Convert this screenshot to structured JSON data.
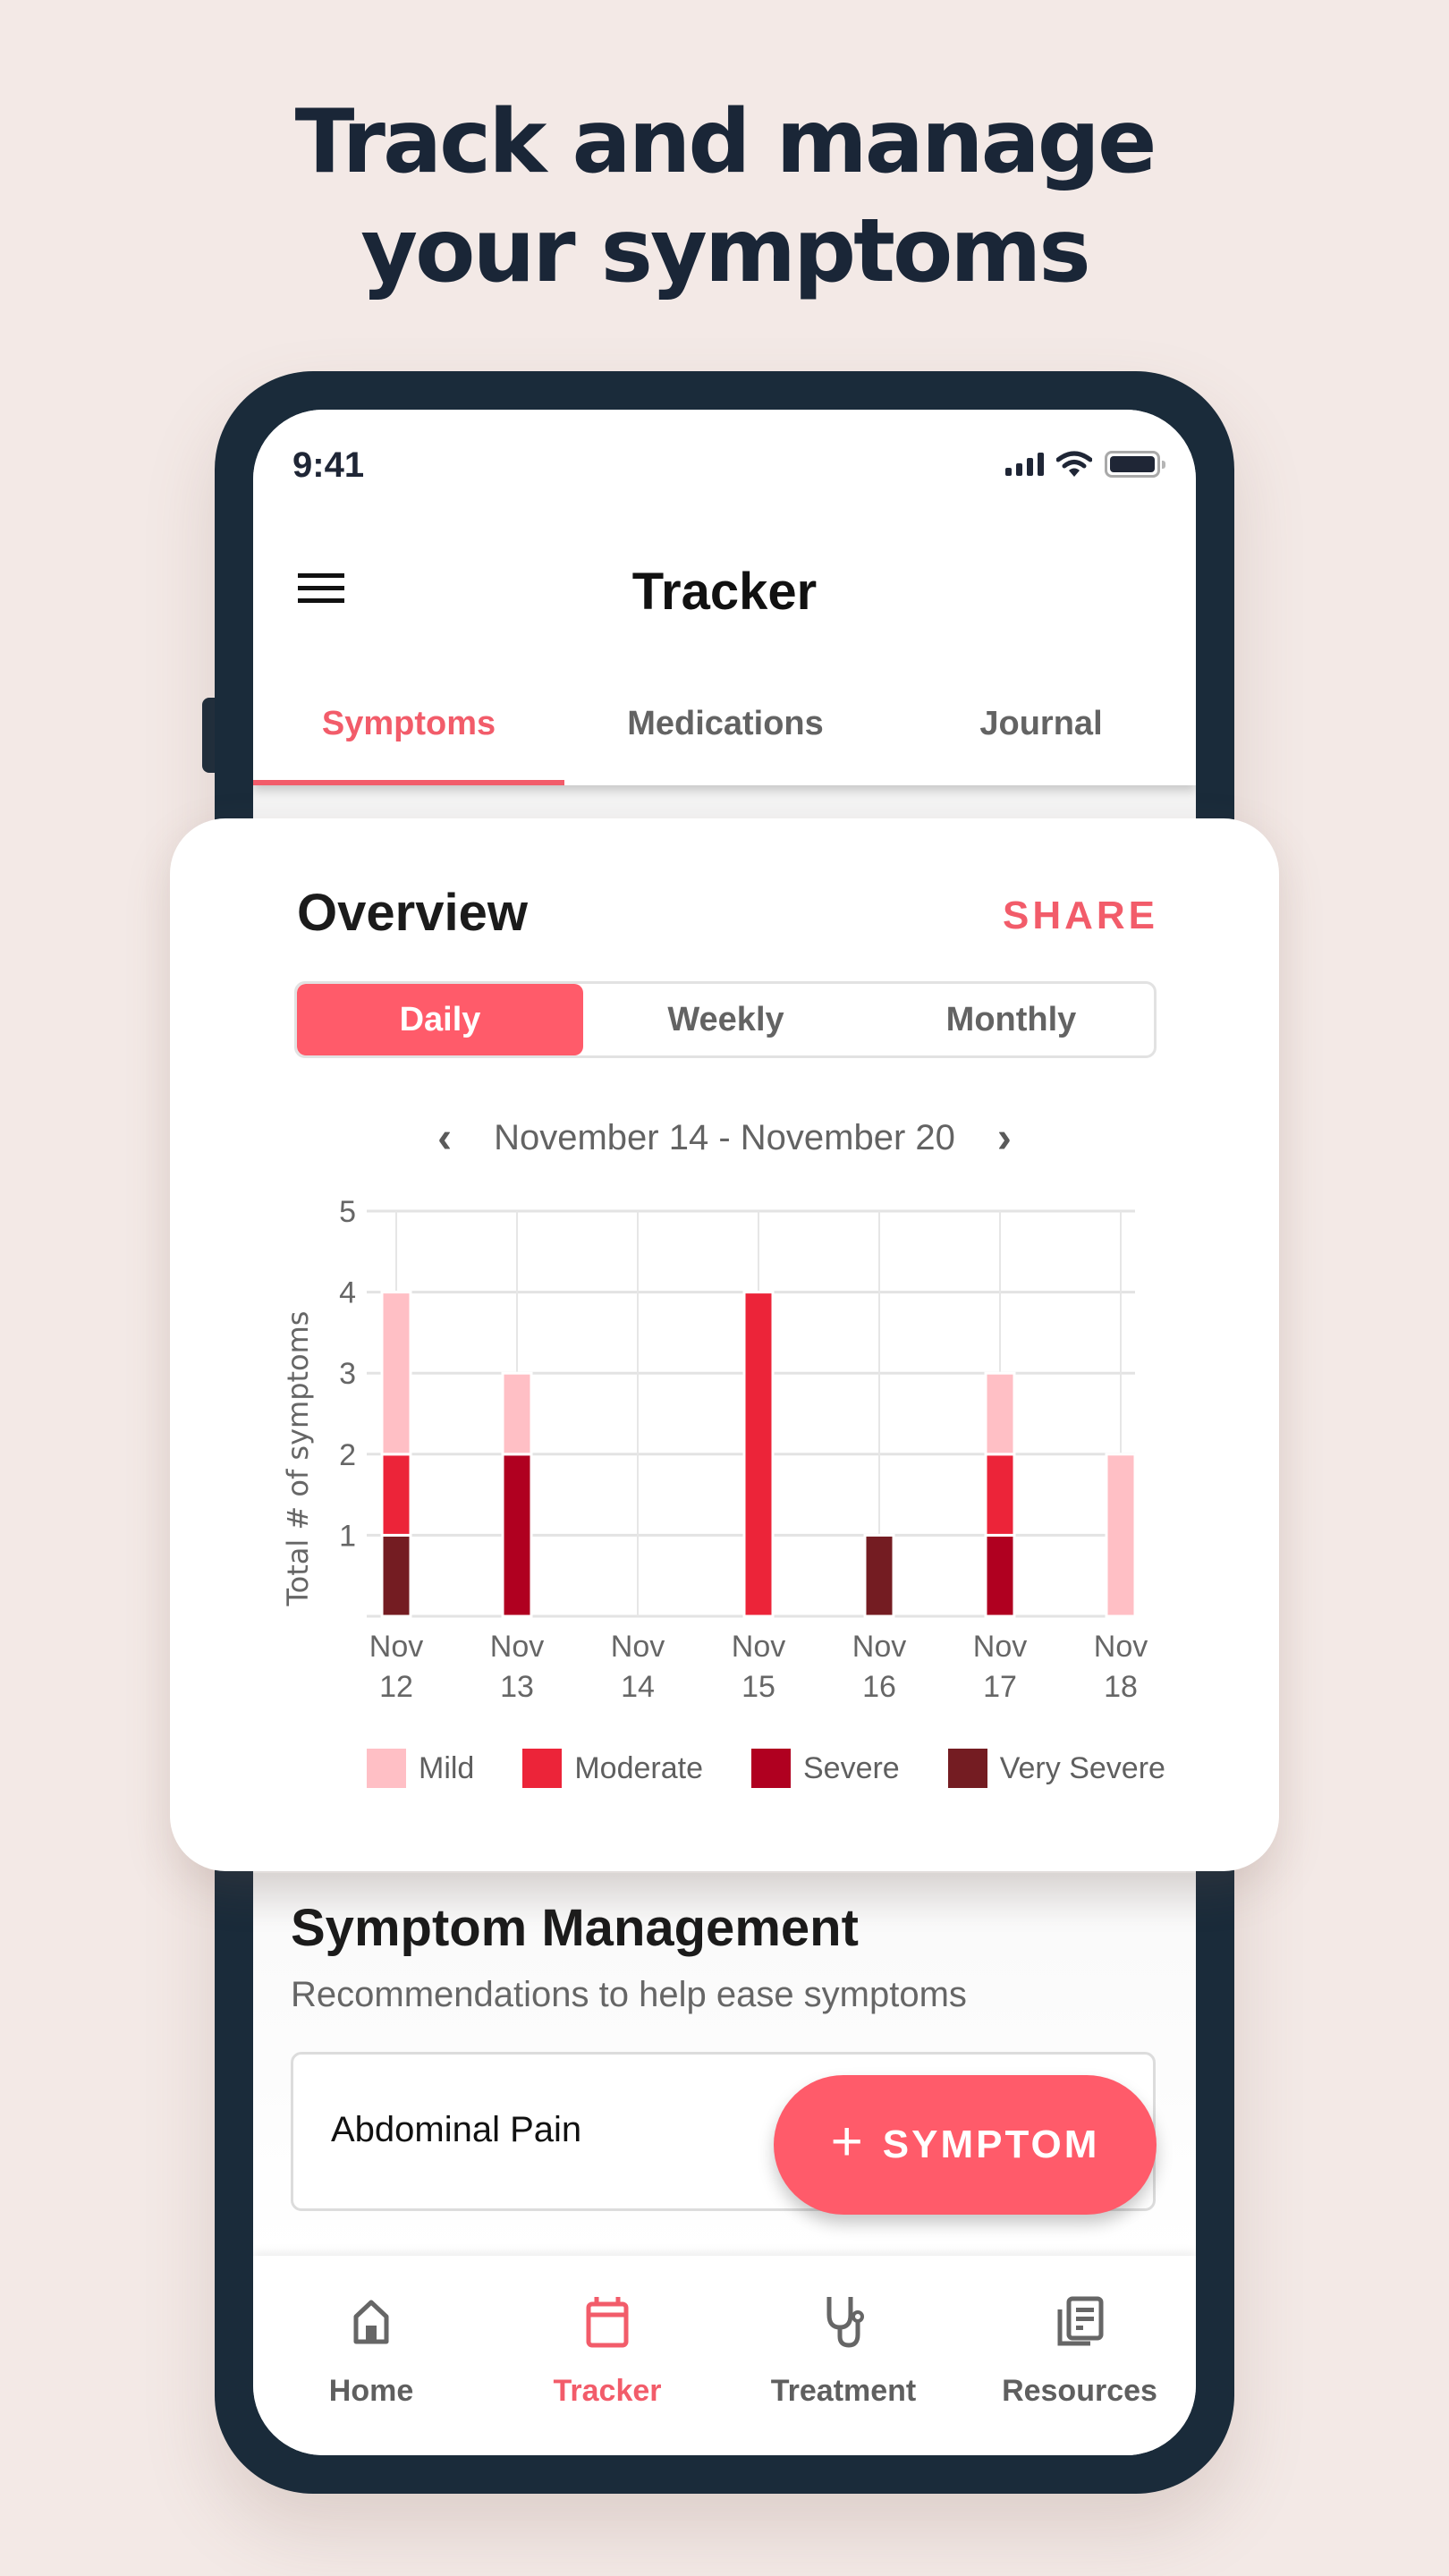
{
  "headline": {
    "line1": "Track and manage",
    "line2": "your symptoms"
  },
  "status_bar": {
    "time": "9:41",
    "icons": [
      "signal-icon",
      "wifi-icon",
      "battery-icon"
    ]
  },
  "app_bar": {
    "title": "Tracker",
    "menu_icon": "hamburger-menu-icon"
  },
  "tabs": [
    {
      "label": "Symptoms",
      "active": true
    },
    {
      "label": "Medications",
      "active": false
    },
    {
      "label": "Journal",
      "active": false
    }
  ],
  "overview": {
    "title": "Overview",
    "share_label": "SHARE",
    "periods": [
      {
        "label": "Daily",
        "active": true
      },
      {
        "label": "Weekly",
        "active": false
      },
      {
        "label": "Monthly",
        "active": false
      }
    ],
    "date_range": "November 14 - November 20",
    "prev_icon": "chevron-left-icon",
    "next_icon": "chevron-right-icon"
  },
  "chart_data": {
    "type": "bar",
    "stacked": true,
    "title": "",
    "xlabel": "",
    "ylabel": "Total # of symptoms",
    "ylim": [
      0,
      5
    ],
    "yticks": [
      1,
      2,
      3,
      4,
      5
    ],
    "grid": true,
    "legend_position": "bottom",
    "categories": [
      [
        "Nov",
        "12"
      ],
      [
        "Nov",
        "13"
      ],
      [
        "Nov",
        "14"
      ],
      [
        "Nov",
        "15"
      ],
      [
        "Nov",
        "16"
      ],
      [
        "Nov",
        "17"
      ],
      [
        "Nov",
        "18"
      ]
    ],
    "series": [
      {
        "name": "Very Severe",
        "color": "#741c22",
        "values": [
          1,
          0,
          0,
          0,
          1,
          0,
          0
        ]
      },
      {
        "name": "Severe",
        "color": "#b00020",
        "values": [
          0,
          2,
          0,
          0,
          0,
          1,
          0
        ]
      },
      {
        "name": "Moderate",
        "color": "#ec2439",
        "values": [
          1,
          0,
          0,
          4,
          0,
          1,
          0
        ]
      },
      {
        "name": "Mild",
        "color": "#ffbfc5",
        "values": [
          2,
          1,
          0,
          0,
          0,
          1,
          2
        ]
      }
    ],
    "legend": [
      "Mild",
      "Moderate",
      "Severe",
      "Very Severe"
    ]
  },
  "symptom_management": {
    "title": "Symptom Management",
    "subtitle": "Recommendations to help ease symptoms",
    "items": [
      {
        "label": "Abdominal Pain"
      }
    ]
  },
  "fab": {
    "icon": "plus-icon",
    "plus": "+",
    "label": "SYMPTOM"
  },
  "bottom_nav": [
    {
      "label": "Home",
      "icon": "home-icon",
      "active": false
    },
    {
      "label": "Tracker",
      "icon": "calendar-icon",
      "active": true
    },
    {
      "label": "Treatment",
      "icon": "stethoscope-icon",
      "active": false
    },
    {
      "label": "Resources",
      "icon": "documents-icon",
      "active": false
    }
  ],
  "colors": {
    "accent": "#ff5b6a",
    "accent_text": "#f25c6a",
    "frame": "#1a2b3a",
    "background": "#f3e9e6",
    "headline": "#1a2637"
  }
}
